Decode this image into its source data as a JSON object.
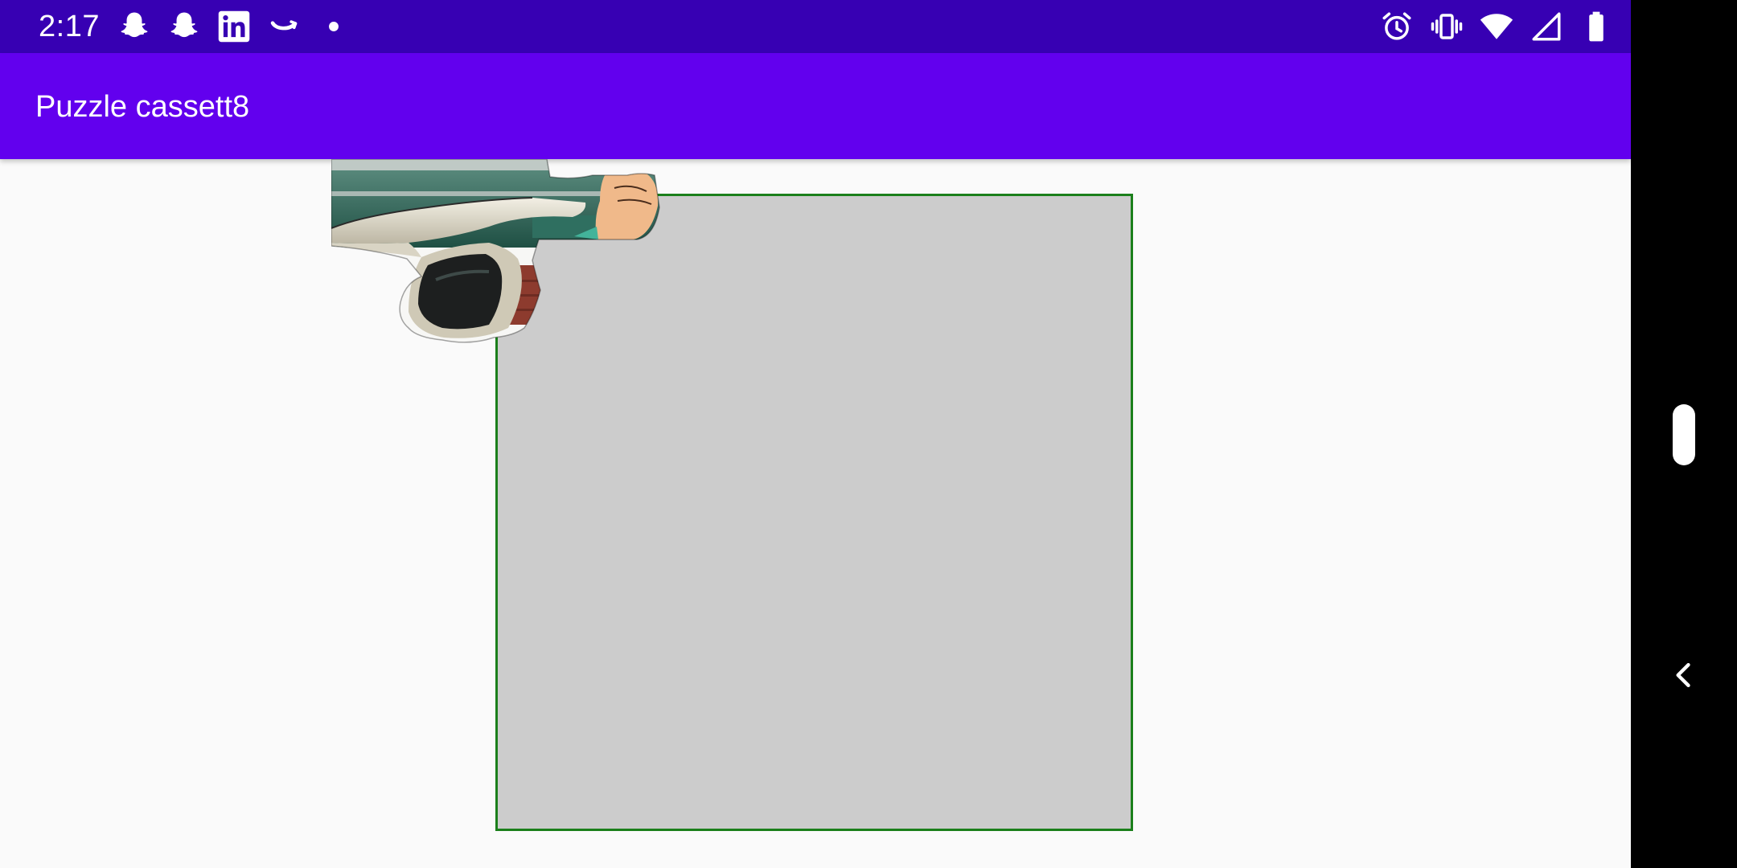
{
  "status_bar": {
    "time": "2:17",
    "background": "#3700b3",
    "left_icons": [
      "snapchat-icon",
      "snapchat-icon",
      "linkedin-icon",
      "amazon-icon",
      "dot-icon"
    ],
    "right_icons": [
      "alarm-icon",
      "vibrate-icon",
      "wifi-icon",
      "cell-signal-icon",
      "battery-icon"
    ]
  },
  "app_bar": {
    "title": "Puzzle cassett8",
    "background": "#6200ee"
  },
  "board": {
    "fill": "#cccccc",
    "border": "#1b7f1b"
  },
  "piece": {
    "subject": "car-photo-fragment"
  },
  "nav_bar": {
    "background": "#000000",
    "buttons": [
      "home-pill",
      "back-icon"
    ]
  }
}
